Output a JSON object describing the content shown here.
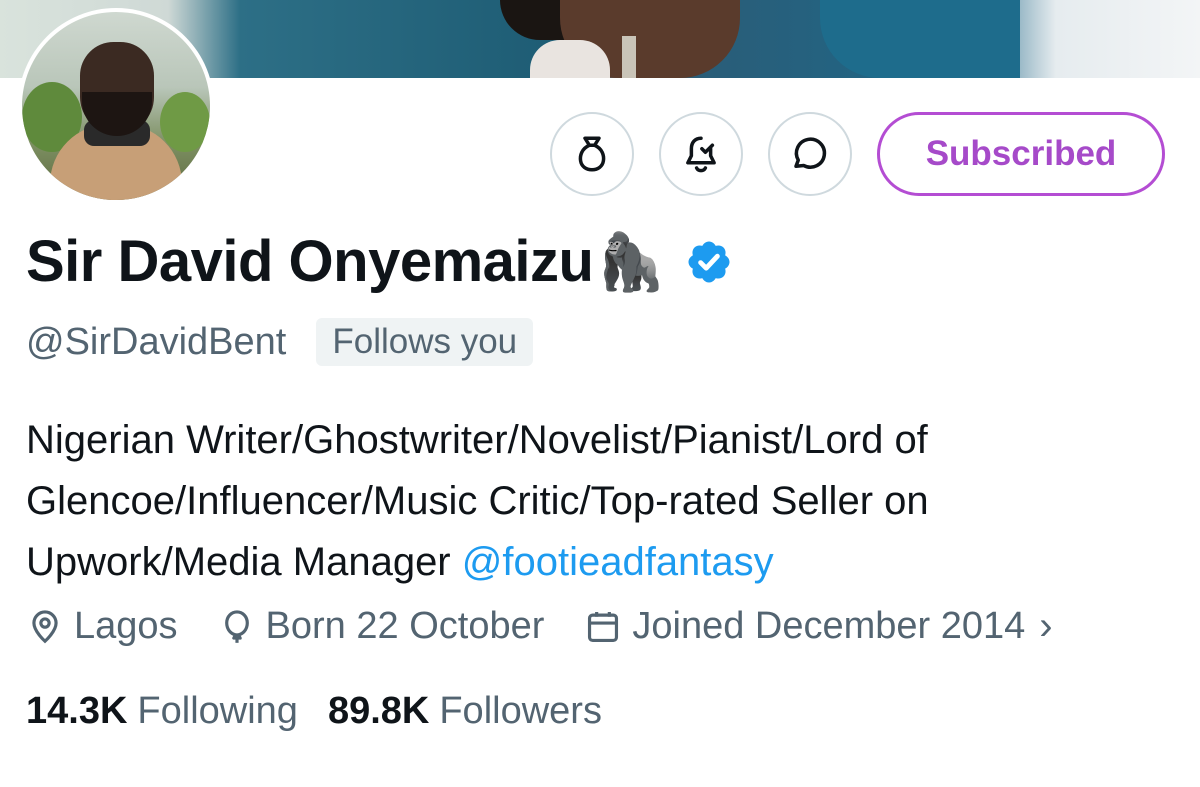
{
  "profile": {
    "display_name": "Sir David Onyemaizu",
    "name_emoji": "🦍",
    "handle": "@SirDavidBent",
    "follows_you": "Follows you",
    "bio_text": "Nigerian Writer/Ghostwriter/Novelist/Pianist/Lord of Glencoe/Influencer/Music Critic/Top-rated Seller on Upwork/Media Manager ",
    "bio_mention": "@footieadfantasy",
    "location": "Lagos",
    "birthday": "Born 22 October",
    "joined": "Joined December 2014",
    "following_count": "14.3K",
    "following_label": "Following",
    "followers_count": "89.8K",
    "followers_label": "Followers"
  },
  "actions": {
    "subscribe_label": "Subscribed",
    "icons": [
      "money-bag-icon",
      "notification-bell-icon",
      "message-icon"
    ]
  },
  "colors": {
    "subscribe_accent": "#a64ac9",
    "verified": "#1d9bf0",
    "link": "#1d9bf0",
    "secondary_text": "#536471"
  }
}
